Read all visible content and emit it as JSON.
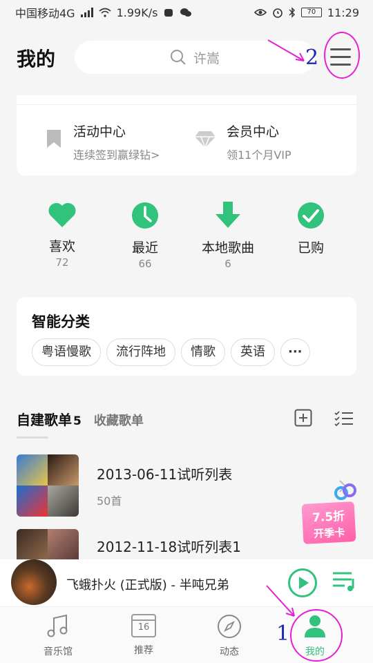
{
  "status_bar": {
    "carrier": "中国移动4G",
    "net_type": "4G",
    "speed": "1.99K/s",
    "battery": "70",
    "time": "11:29"
  },
  "header": {
    "title": "我的",
    "search_placeholder": "许嵩",
    "menu_icon": "hamburger-menu-icon"
  },
  "promo_card": {
    "items": [
      {
        "title": "活动中心",
        "subtitle": "连续签到赢绿钻>",
        "icon": "bookmark-icon"
      },
      {
        "title": "会员中心",
        "subtitle": "领11个月VIP",
        "icon": "diamond-icon"
      }
    ]
  },
  "quick_actions": [
    {
      "label": "喜欢",
      "count": "72",
      "icon": "heart-icon"
    },
    {
      "label": "最近",
      "count": "66",
      "icon": "clock-icon"
    },
    {
      "label": "本地歌曲",
      "count": "6",
      "icon": "download-icon"
    },
    {
      "label": "已购",
      "count": "",
      "icon": "check-icon"
    }
  ],
  "smart_category": {
    "title": "智能分类",
    "tags": [
      "粤语慢歌",
      "流行阵地",
      "情歌",
      "英语"
    ],
    "more_label": "···"
  },
  "playlist_tabs": {
    "active": "自建歌单",
    "active_count": "5",
    "inactive": "收藏歌单"
  },
  "playlists": [
    {
      "name": "2013-06-11试听列表",
      "count": "50首"
    },
    {
      "name": "2012-11-18试听列表1",
      "count": ""
    }
  ],
  "promo_badge": {
    "line1": "7.5折",
    "line2": "开季卡"
  },
  "now_playing": {
    "title": "飞蛾扑火 (正式版) - 半吨兄弟"
  },
  "bottom_nav": [
    {
      "label": "音乐馆",
      "icon": "music-note-icon"
    },
    {
      "label": "推荐",
      "icon": "calendar-icon",
      "badge": "16"
    },
    {
      "label": "动态",
      "icon": "compass-icon"
    },
    {
      "label": "我的",
      "icon": "user-icon"
    }
  ],
  "annotations": {
    "num1": "1",
    "num2": "2"
  },
  "colors": {
    "accent": "#31c27c",
    "annotation_ring": "#e61fd3",
    "annotation_num": "#1a2ab8"
  }
}
